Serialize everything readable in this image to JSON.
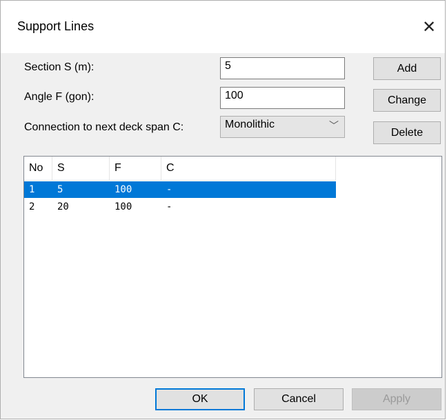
{
  "window": {
    "title": "Support Lines",
    "close_glyph": "✕"
  },
  "form": {
    "section_label": "Section S (m):",
    "section_value": "5",
    "angle_label": "Angle F (gon):",
    "angle_value": "100",
    "connection_label": "Connection to next deck span C:",
    "connection_selected": "Monolithic"
  },
  "side_buttons": {
    "add": "Add",
    "change": "Change",
    "delete": "Delete"
  },
  "table": {
    "columns": [
      "No",
      "S",
      "F",
      "C"
    ],
    "rows": [
      {
        "no": "1",
        "s": "5",
        "f": "100",
        "c": "-",
        "selected": true
      },
      {
        "no": "2",
        "s": "20",
        "f": "100",
        "c": "-",
        "selected": false
      }
    ]
  },
  "footer": {
    "ok": "OK",
    "cancel": "Cancel",
    "apply": "Apply"
  },
  "colors": {
    "selection": "#0078d7",
    "dialog_bg": "#f0f0f0"
  },
  "icons": {
    "close": "close-icon",
    "dropdown": "chevron-down-icon"
  }
}
